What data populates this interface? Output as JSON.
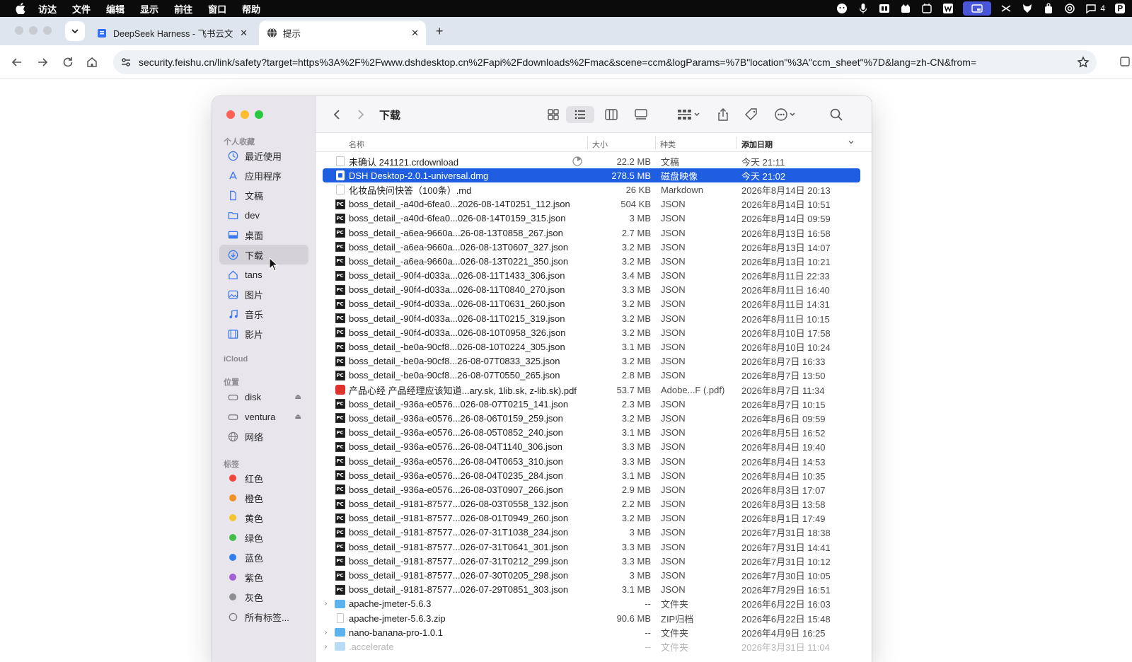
{
  "menubar": {
    "items": [
      "访达",
      "文件",
      "编辑",
      "显示",
      "前往",
      "窗口",
      "帮助"
    ],
    "badge_count": "4",
    "icons": [
      "chat-bubble-icon",
      "microphone-icon",
      "keyboard-icon",
      "cat-icon",
      "calendar-icon",
      "w-icon",
      "screen-share-icon",
      "hand-icon",
      "fox-icon",
      "bag-icon",
      "openai-icon",
      "message-icon",
      "p-icon"
    ]
  },
  "browser": {
    "tabs": [
      {
        "title": "DeepSeek Harness - 飞书云文",
        "icon": "feishu-doc-icon"
      },
      {
        "title": "提示",
        "icon": "globe-icon"
      }
    ],
    "url": "security.feishu.cn/link/safety?target=https%3A%2F%2Fwww.dshdesktop.cn%2Fapi%2Fdownloads%2Fmac&scene=ccm&logParams=%7B\"location\"%3A\"ccm_sheet\"%7D&lang=zh-CN&from="
  },
  "finder": {
    "title": "下载",
    "sidebar": {
      "favorites_header": "个人收藏",
      "favorites": [
        {
          "label": "最近使用",
          "icon": "clock-icon"
        },
        {
          "label": "应用程序",
          "icon": "applications-icon"
        },
        {
          "label": "文稿",
          "icon": "document-icon"
        },
        {
          "label": "dev",
          "icon": "folder-icon"
        },
        {
          "label": "桌面",
          "icon": "desktop-icon"
        },
        {
          "label": "下载",
          "icon": "download-icon"
        },
        {
          "label": "tans",
          "icon": "home-icon"
        },
        {
          "label": "图片",
          "icon": "photo-icon"
        },
        {
          "label": "音乐",
          "icon": "music-icon"
        },
        {
          "label": "影片",
          "icon": "film-icon"
        }
      ],
      "icloud_header": "iCloud",
      "locations_header": "位置",
      "locations": [
        {
          "label": "disk",
          "icon": "disk-icon",
          "eject": true
        },
        {
          "label": "ventura",
          "icon": "disk-icon",
          "eject": true
        },
        {
          "label": "网络",
          "icon": "network-icon",
          "eject": false
        }
      ],
      "tags_header": "标签",
      "tags": [
        {
          "label": "红色",
          "color": "#f0453a"
        },
        {
          "label": "橙色",
          "color": "#f29224"
        },
        {
          "label": "黄色",
          "color": "#f6c52d"
        },
        {
          "label": "绿色",
          "color": "#3fbe4a"
        },
        {
          "label": "蓝色",
          "color": "#2f7ef0"
        },
        {
          "label": "紫色",
          "color": "#a45fd6"
        },
        {
          "label": "灰色",
          "color": "#8e8e93"
        },
        {
          "label": "所有标签...",
          "color": ""
        }
      ]
    },
    "columns": {
      "name": "名称",
      "size": "大小",
      "kind": "种类",
      "date": "添加日期"
    },
    "files": [
      {
        "name": "未确认 241121.crdownload",
        "size": "22.2 MB",
        "kind": "文稿",
        "date": "今天 21:11",
        "icon": "doc",
        "progress": true
      },
      {
        "name": "DSH Desktop-2.0.1-universal.dmg",
        "size": "278.5 MB",
        "kind": "磁盘映像",
        "date": "今天 21:02",
        "icon": "dmg",
        "selected": true
      },
      {
        "name": "化妆品快问快答（100条）.md",
        "size": "26 KB",
        "kind": "Markdown",
        "date": "2026年8月14日 20:13",
        "icon": "doc"
      },
      {
        "name": "boss_detail_-a40d-6fea0...2026-08-14T0251_112.json",
        "size": "504 KB",
        "kind": "JSON",
        "date": "2026年8月14日 10:51",
        "icon": "pc"
      },
      {
        "name": "boss_detail_-a40d-6fea0...026-08-14T0159_315.json",
        "size": "3 MB",
        "kind": "JSON",
        "date": "2026年8月14日 09:59",
        "icon": "pc"
      },
      {
        "name": "boss_detail_-a6ea-9660a...26-08-13T0858_267.json",
        "size": "2.7 MB",
        "kind": "JSON",
        "date": "2026年8月13日 16:58",
        "icon": "pc"
      },
      {
        "name": "boss_detail_-a6ea-9660a...026-08-13T0607_327.json",
        "size": "3.2 MB",
        "kind": "JSON",
        "date": "2026年8月13日 14:07",
        "icon": "pc"
      },
      {
        "name": "boss_detail_-a6ea-9660a...026-08-13T0221_350.json",
        "size": "3.2 MB",
        "kind": "JSON",
        "date": "2026年8月13日 10:21",
        "icon": "pc"
      },
      {
        "name": "boss_detail_-90f4-d033a...026-08-11T1433_306.json",
        "size": "3.4 MB",
        "kind": "JSON",
        "date": "2026年8月11日 22:33",
        "icon": "pc"
      },
      {
        "name": "boss_detail_-90f4-d033a...026-08-11T0840_270.json",
        "size": "3.3 MB",
        "kind": "JSON",
        "date": "2026年8月11日 16:40",
        "icon": "pc"
      },
      {
        "name": "boss_detail_-90f4-d033a...026-08-11T0631_260.json",
        "size": "3.2 MB",
        "kind": "JSON",
        "date": "2026年8月11日 14:31",
        "icon": "pc"
      },
      {
        "name": "boss_detail_-90f4-d033a...026-08-11T0215_319.json",
        "size": "3.2 MB",
        "kind": "JSON",
        "date": "2026年8月11日 10:15",
        "icon": "pc"
      },
      {
        "name": "boss_detail_-90f4-d033a...026-08-10T0958_326.json",
        "size": "3.2 MB",
        "kind": "JSON",
        "date": "2026年8月10日 17:58",
        "icon": "pc"
      },
      {
        "name": "boss_detail_-be0a-90cf8...026-08-10T0224_305.json",
        "size": "3.1 MB",
        "kind": "JSON",
        "date": "2026年8月10日 10:24",
        "icon": "pc"
      },
      {
        "name": "boss_detail_-be0a-90cf8...26-08-07T0833_325.json",
        "size": "3.2 MB",
        "kind": "JSON",
        "date": "2026年8月7日 16:33",
        "icon": "pc"
      },
      {
        "name": "boss_detail_-be0a-90cf8...26-08-07T0550_265.json",
        "size": "2.8 MB",
        "kind": "JSON",
        "date": "2026年8月7日 13:50",
        "icon": "pc"
      },
      {
        "name": "产品心经 产品经理应该知道...ary.sk, 1lib.sk, z-lib.sk).pdf",
        "size": "53.7 MB",
        "kind": "Adobe...F (.pdf)",
        "date": "2026年8月7日 11:34",
        "icon": "pdf"
      },
      {
        "name": "boss_detail_-936a-e0576...026-08-07T0215_141.json",
        "size": "2.3 MB",
        "kind": "JSON",
        "date": "2026年8月7日 10:15",
        "icon": "pc"
      },
      {
        "name": "boss_detail_-936a-e0576...26-08-06T0159_259.json",
        "size": "3.2 MB",
        "kind": "JSON",
        "date": "2026年8月6日 09:59",
        "icon": "pc"
      },
      {
        "name": "boss_detail_-936a-e0576...26-08-05T0852_240.json",
        "size": "3.1 MB",
        "kind": "JSON",
        "date": "2026年8月5日 16:52",
        "icon": "pc"
      },
      {
        "name": "boss_detail_-936a-e0576...26-08-04T1140_306.json",
        "size": "3.3 MB",
        "kind": "JSON",
        "date": "2026年8月4日 19:40",
        "icon": "pc"
      },
      {
        "name": "boss_detail_-936a-e0576...26-08-04T0653_310.json",
        "size": "3.3 MB",
        "kind": "JSON",
        "date": "2026年8月4日 14:53",
        "icon": "pc"
      },
      {
        "name": "boss_detail_-936a-e0576...26-08-04T0235_284.json",
        "size": "3.1 MB",
        "kind": "JSON",
        "date": "2026年8月4日 10:35",
        "icon": "pc"
      },
      {
        "name": "boss_detail_-936a-e0576...26-08-03T0907_266.json",
        "size": "2.9 MB",
        "kind": "JSON",
        "date": "2026年8月3日 17:07",
        "icon": "pc"
      },
      {
        "name": "boss_detail_-9181-87577...026-08-03T0558_132.json",
        "size": "2.2 MB",
        "kind": "JSON",
        "date": "2026年8月3日 13:58",
        "icon": "pc"
      },
      {
        "name": "boss_detail_-9181-87577...026-08-01T0949_260.json",
        "size": "3.2 MB",
        "kind": "JSON",
        "date": "2026年8月1日 17:49",
        "icon": "pc"
      },
      {
        "name": "boss_detail_-9181-87577...026-07-31T1038_234.json",
        "size": "3 MB",
        "kind": "JSON",
        "date": "2026年7月31日 18:38",
        "icon": "pc"
      },
      {
        "name": "boss_detail_-9181-87577...026-07-31T0641_301.json",
        "size": "3.3 MB",
        "kind": "JSON",
        "date": "2026年7月31日 14:41",
        "icon": "pc"
      },
      {
        "name": "boss_detail_-9181-87577...026-07-31T0212_299.json",
        "size": "3.3 MB",
        "kind": "JSON",
        "date": "2026年7月31日 10:12",
        "icon": "pc"
      },
      {
        "name": "boss_detail_-9181-87577...026-07-30T0205_298.json",
        "size": "3 MB",
        "kind": "JSON",
        "date": "2026年7月30日 10:05",
        "icon": "pc"
      },
      {
        "name": "boss_detail_-9181-87577...026-07-29T0851_303.json",
        "size": "3.1 MB",
        "kind": "JSON",
        "date": "2026年7月29日 16:51",
        "icon": "pc"
      },
      {
        "name": "apache-jmeter-5.6.3",
        "size": "--",
        "kind": "文件夹",
        "date": "2026年6月22日 16:03",
        "icon": "folder",
        "disclosure": true
      },
      {
        "name": "apache-jmeter-5.6.3.zip",
        "size": "90.6 MB",
        "kind": "ZIP归档",
        "date": "2026年6月22日 15:48",
        "icon": "zip"
      },
      {
        "name": "nano-banana-pro-1.0.1",
        "size": "--",
        "kind": "文件夹",
        "date": "2026年4月9日 16:25",
        "icon": "folder",
        "disclosure": true
      },
      {
        "name": ".accelerate",
        "size": "--",
        "kind": "文件夹",
        "date": "2026年3月31日 11:04",
        "icon": "folder",
        "disclosure": true,
        "faded": true
      }
    ]
  }
}
